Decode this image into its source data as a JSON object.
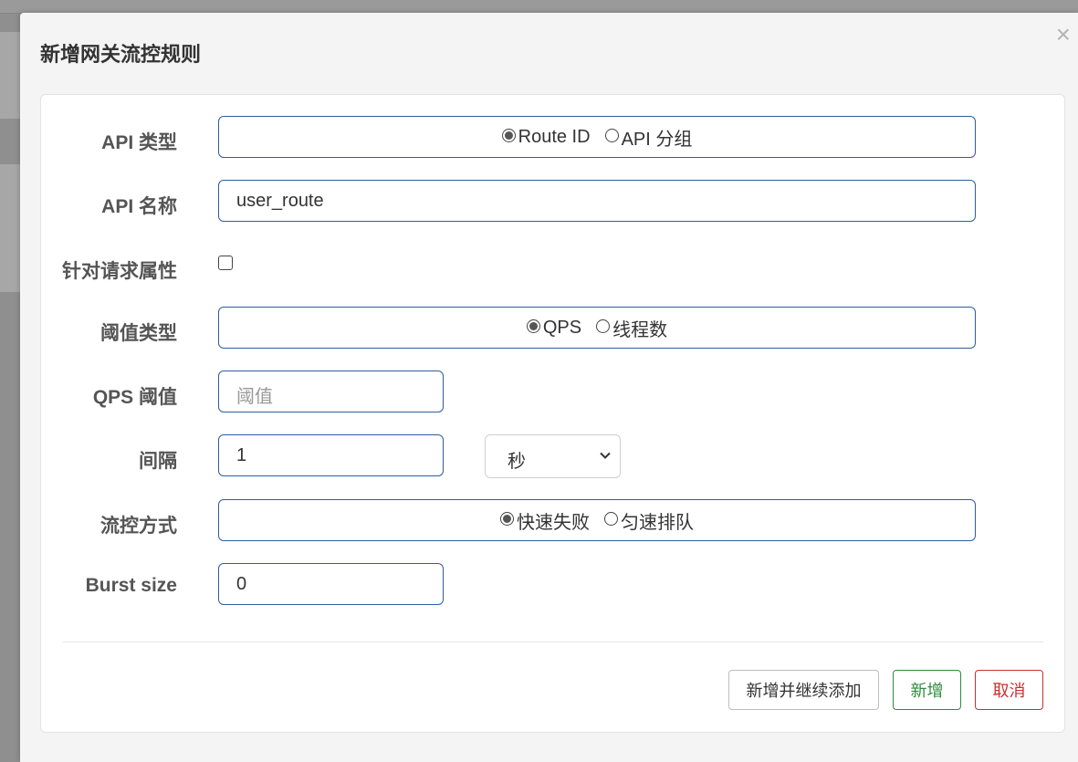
{
  "dialog": {
    "title": "新增网关流控规则",
    "close_glyph": "×"
  },
  "form": {
    "api_type": {
      "label": "API 类型",
      "options": [
        {
          "label": "Route ID",
          "checked": true
        },
        {
          "label": "API 分组",
          "checked": false
        }
      ]
    },
    "api_name": {
      "label": "API 名称",
      "value": "user_route"
    },
    "request_attr": {
      "label": "针对请求属性",
      "checked": false
    },
    "threshold_type": {
      "label": "阈值类型",
      "options": [
        {
          "label": "QPS",
          "checked": true
        },
        {
          "label": "线程数",
          "checked": false
        }
      ]
    },
    "qps_threshold": {
      "label": "QPS 阈值",
      "placeholder": "阈值",
      "value": ""
    },
    "interval": {
      "label": "间隔",
      "value": "1",
      "unit": "秒"
    },
    "control_behavior": {
      "label": "流控方式",
      "options": [
        {
          "label": "快速失败",
          "checked": true
        },
        {
          "label": "匀速排队",
          "checked": false
        }
      ]
    },
    "burst_size": {
      "label": "Burst size",
      "value": "0"
    }
  },
  "footer": {
    "add_continue_label": "新增并继续添加",
    "add_label": "新增",
    "cancel_label": "取消"
  },
  "colors": {
    "input_border": "#2f5e9c",
    "add_button": "#2e8b3e",
    "cancel_button": "#c9302c"
  }
}
